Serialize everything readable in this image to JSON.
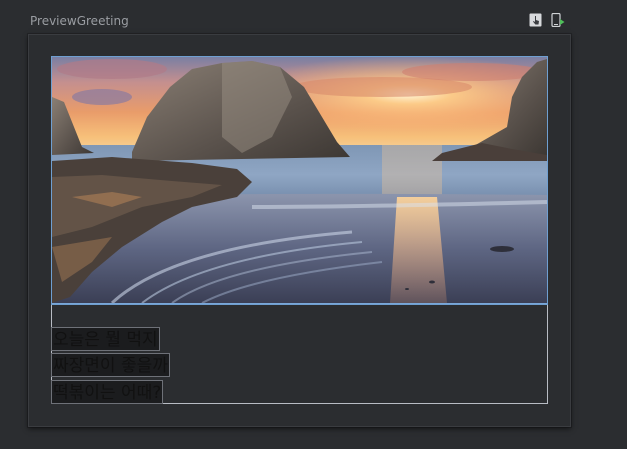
{
  "preview": {
    "title": "PreviewGreeting",
    "toolbar": {
      "interactive_icon": "interactive-mode-icon",
      "deploy_icon": "deploy-to-device-icon"
    }
  },
  "content": {
    "image": {
      "subject": "sunset-beach-sea-stacks"
    },
    "lines": [
      "오늘은 뭘 먹지",
      "짜장면이 좋을까",
      "떡볶이는 어때?"
    ]
  },
  "colors": {
    "background": "#2b2d30",
    "frame_border": "#3a3c40",
    "bounds_outline": "#b8bcc4",
    "image_outline": "#6f9fd1",
    "text_highlight": "#1b1c1e",
    "deploy_accent": "#4fbf5a"
  }
}
